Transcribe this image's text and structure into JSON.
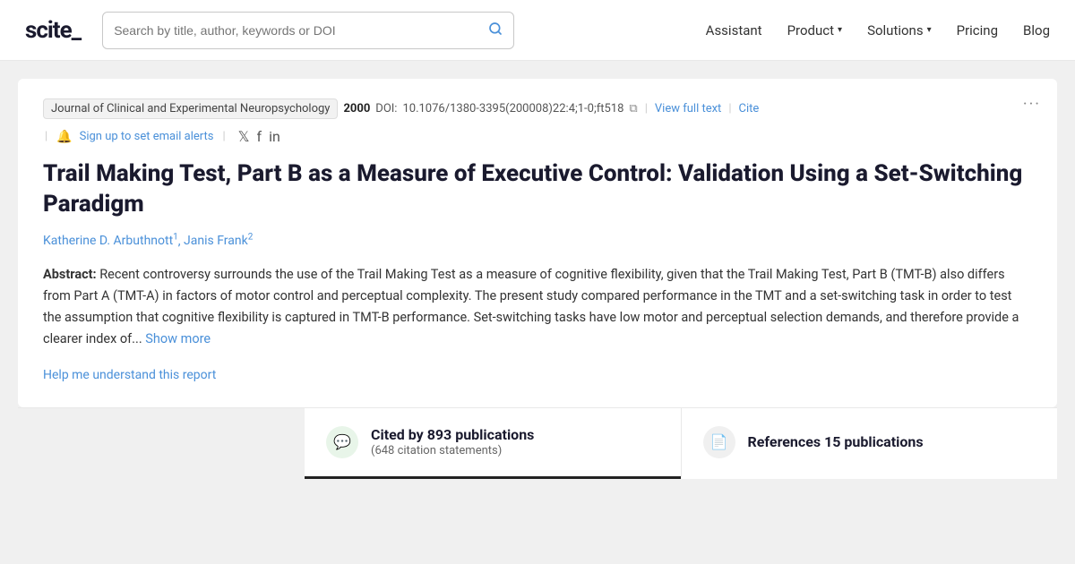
{
  "navbar": {
    "logo_text": "scite_",
    "search_placeholder": "Search by title, author, keywords or DOI",
    "nav_items": [
      {
        "label": "Assistant",
        "has_dropdown": false
      },
      {
        "label": "Product",
        "has_dropdown": true
      },
      {
        "label": "Solutions",
        "has_dropdown": true
      },
      {
        "label": "Pricing",
        "has_dropdown": false
      },
      {
        "label": "Blog",
        "has_dropdown": false
      }
    ]
  },
  "article": {
    "journal": "Journal of Clinical and Experimental Neuropsychology",
    "year": "2000",
    "doi_label": "DOI:",
    "doi_value": "10.1076/1380-3395(200008)22:4;1-0;ft518",
    "view_full_text": "View full text",
    "cite_label": "Cite",
    "alert_text": "Sign up to set email alerts",
    "title": "Trail Making Test, Part B as a Measure of Executive Control: Validation Using a Set-Switching Paradigm",
    "authors": [
      {
        "name": "Katherine D. Arbuthnott",
        "sup": "1"
      },
      {
        "name": "Janis Frank",
        "sup": "2"
      }
    ],
    "abstract_label": "Abstract:",
    "abstract_body": "Recent controversy surrounds the use of the Trail Making Test as a measure of cognitive flexibility, given that the Trail Making Test, Part B (TMT-B) also differs from Part A (TMT-A) in factors of motor control and perceptual complexity. The present study compared performance in the TMT and a set-switching task in order to test the assumption that cognitive flexibility is captured in TMT-B performance. Set-switching tasks have low motor and perceptual selection demands, and therefore provide a clearer index of...",
    "show_more_label": "Show more",
    "help_link": "Help me understand this report",
    "more_btn": "···"
  },
  "stats": [
    {
      "icon": "💬",
      "icon_color": "green",
      "main_text": "Cited by 893 publications",
      "sub_text": "(648 citation statements)",
      "active": true
    },
    {
      "icon": "📄",
      "icon_color": "gray",
      "main_text": "References 15 publications",
      "sub_text": "",
      "active": false
    }
  ]
}
